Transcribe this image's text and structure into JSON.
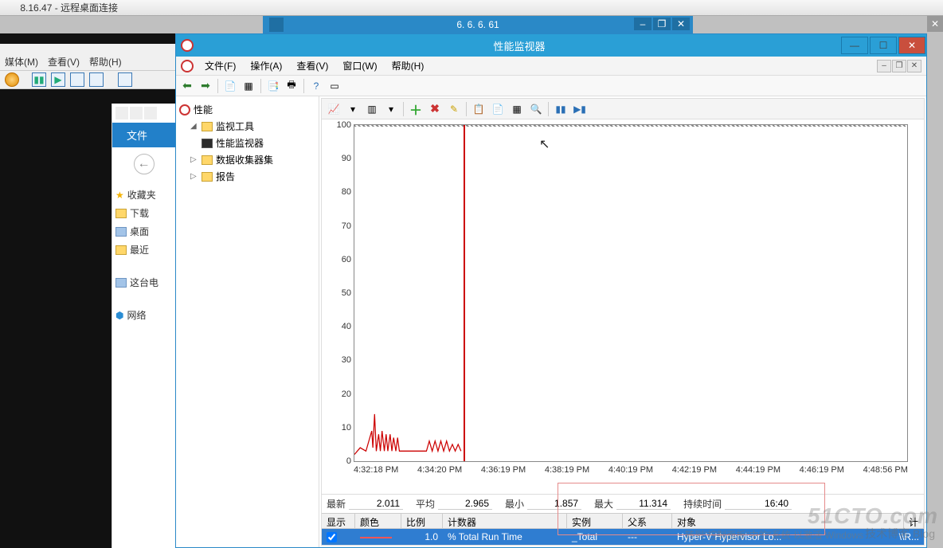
{
  "rdp": {
    "title": "8.16.47 - 远程桌面连接",
    "connection_ip": "6. 6. 6. 61"
  },
  "host": {
    "menu": {
      "media": "媒体(M)",
      "view": "查看(V)",
      "help": "帮助(H)"
    }
  },
  "explorer": {
    "file_tab": "文件",
    "favorites": "收藏夹",
    "downloads": "下载",
    "desktop": "桌面",
    "recent": "最近",
    "this_pc": "这台电",
    "network": "网络"
  },
  "perfmon": {
    "title": "性能监视器",
    "menu": {
      "file": "文件(F)",
      "action": "操作(A)",
      "view": "查看(V)",
      "window": "窗口(W)",
      "help": "帮助(H)"
    },
    "tree": {
      "root": "性能",
      "tools": "监视工具",
      "monitor": "性能监视器",
      "collectors": "数据收集器集",
      "reports": "报告"
    },
    "chart_data": {
      "type": "line",
      "ylim": [
        0,
        100
      ],
      "yticks": [
        100,
        90,
        80,
        70,
        60,
        50,
        40,
        30,
        20,
        10,
        0
      ],
      "xticks": [
        "4:32:18 PM",
        "4:34:20 PM",
        "4:36:19 PM",
        "4:38:19 PM",
        "4:40:19 PM",
        "4:42:19 PM",
        "4:44:19 PM",
        "4:46:19 PM",
        "4:48:56 PM"
      ],
      "timeline_x_pct": 19.8,
      "series": [
        {
          "name": "% Total Run Time",
          "color": "#c00",
          "points": [
            [
              0,
              2
            ],
            [
              1,
              4
            ],
            [
              2,
              3
            ],
            [
              3,
              9
            ],
            [
              3.2,
              4
            ],
            [
              3.5,
              14
            ],
            [
              3.8,
              3
            ],
            [
              4.2,
              8
            ],
            [
              4.5,
              3
            ],
            [
              4.8,
              9
            ],
            [
              5.2,
              3
            ],
            [
              5.5,
              8
            ],
            [
              5.8,
              3
            ],
            [
              6.2,
              8
            ],
            [
              6.5,
              3
            ],
            [
              6.8,
              7
            ],
            [
              7.2,
              3
            ],
            [
              7.5,
              7
            ],
            [
              7.8,
              3
            ],
            [
              8.2,
              3
            ],
            [
              9,
              3
            ],
            [
              10,
              3
            ],
            [
              11,
              3
            ],
            [
              12.5,
              3
            ],
            [
              13,
              6
            ],
            [
              13.5,
              3
            ],
            [
              14,
              6
            ],
            [
              14.5,
              3
            ],
            [
              15,
              6
            ],
            [
              15.5,
              3
            ],
            [
              16,
              6
            ],
            [
              16.5,
              3
            ],
            [
              17,
              5
            ],
            [
              17.5,
              3
            ],
            [
              18,
              5
            ],
            [
              18.5,
              3
            ]
          ]
        }
      ]
    },
    "stats": {
      "latest_lbl": "最新",
      "latest": "2.011",
      "avg_lbl": "平均",
      "avg": "2.965",
      "min_lbl": "最小",
      "min": "1.857",
      "max_lbl": "最大",
      "max": "11.314",
      "dur_lbl": "持续时间",
      "dur": "16:40"
    },
    "columns": {
      "show": "显示",
      "color": "颜色",
      "scale": "比例",
      "counter": "计数器",
      "instance": "实例",
      "parent": "父系",
      "object": "对象",
      "computer": "计"
    },
    "row": {
      "scale": "1.0",
      "counter": "% Total Run Time",
      "instance": "_Total",
      "parent": "---",
      "object": "Hyper-V Hypervisor Lo...",
      "computer": "\\\\R..."
    }
  },
  "watermark": {
    "big": "51CTO.com",
    "small": "技术博客      Blog"
  },
  "footer": "转到\"控制面板\"中的\"系统 以激活 Windows"
}
